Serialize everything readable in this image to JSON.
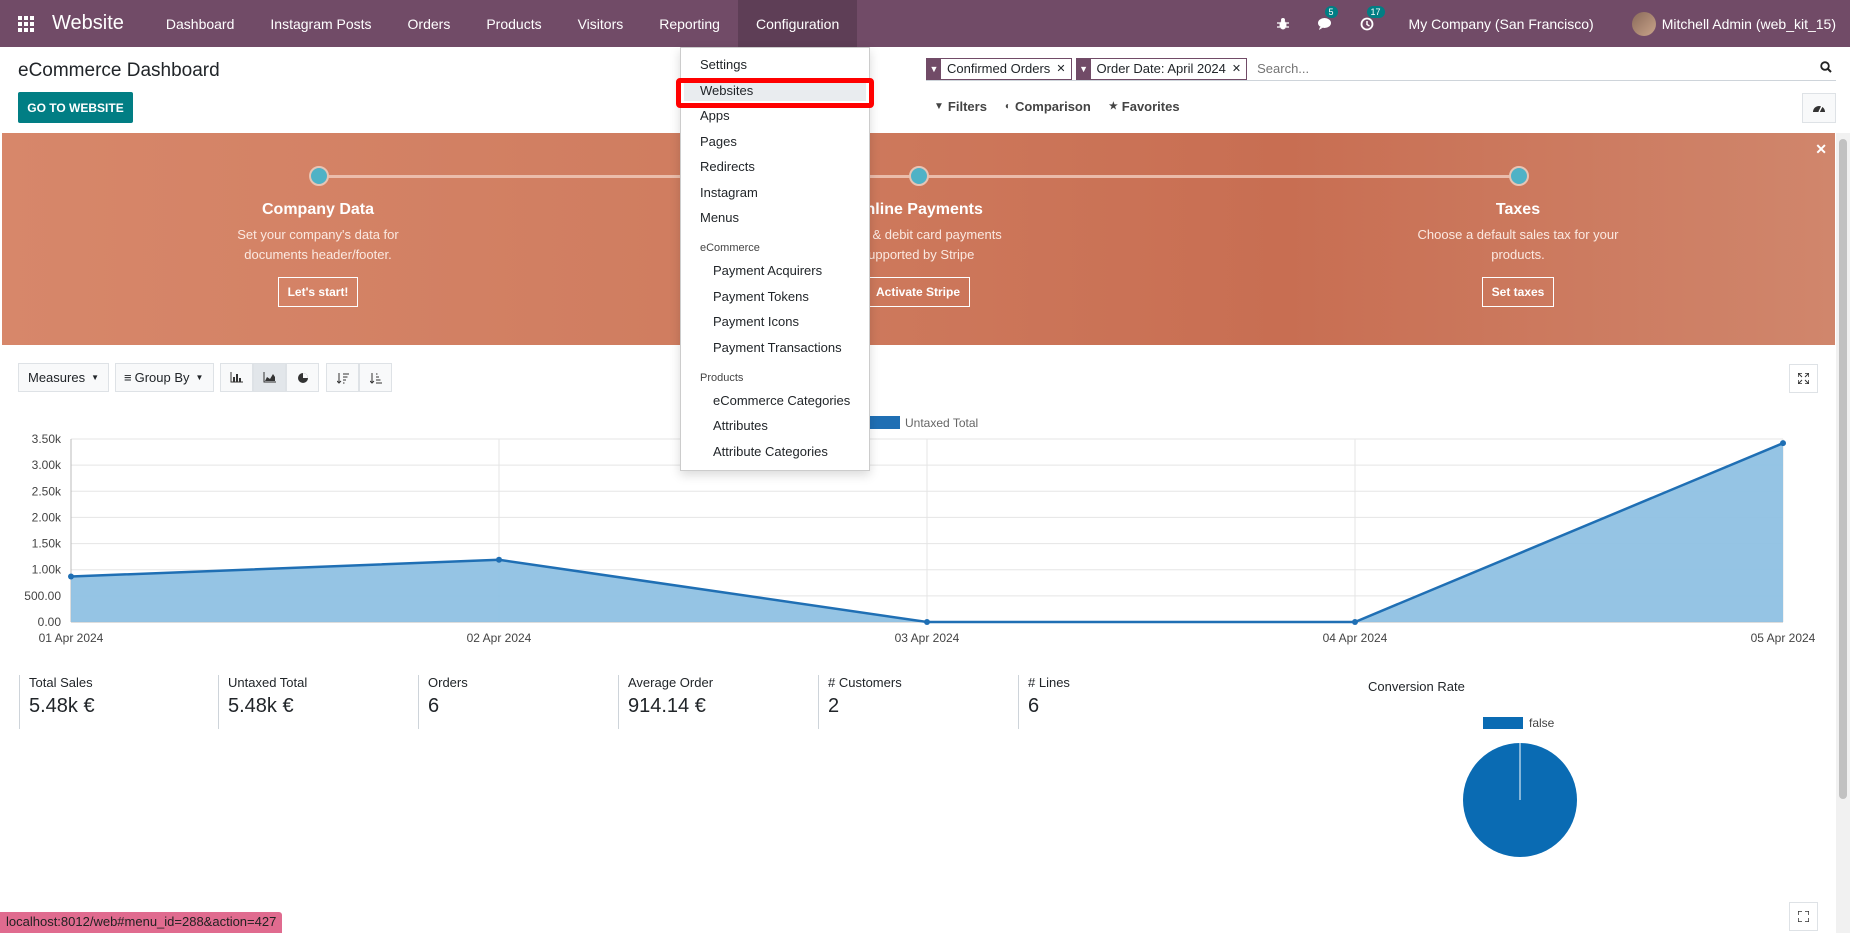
{
  "navbar": {
    "app_name": "Website",
    "menu": [
      "Dashboard",
      "Instagram Posts",
      "Orders",
      "Products",
      "Visitors",
      "Reporting",
      "Configuration"
    ],
    "messages_count": "5",
    "activities_count": "17",
    "company": "My Company (San Francisco)",
    "user": "Mitchell Admin (web_kit_15)",
    "color": "#714B67"
  },
  "control_panel": {
    "title": "eCommerce Dashboard",
    "go_button": "GO TO WEBSITE",
    "facets": [
      "Confirmed Orders",
      "Order Date: April 2024"
    ],
    "search_placeholder": "Search...",
    "filters": "Filters",
    "comparison": "Comparison",
    "favorites": "Favorites"
  },
  "banner": {
    "steps": [
      {
        "title": "Company Data",
        "desc1": "Set your company's data for",
        "desc2": "documents header/footer.",
        "button": "Let's start!"
      },
      {
        "title": "Online Payments",
        "desc1": "Credit & debit card payments",
        "desc2": "supported by Stripe",
        "button": "Activate Stripe"
      },
      {
        "title": "Taxes",
        "desc1": "Choose a default sales tax for your",
        "desc2": "products.",
        "button": "Set taxes"
      }
    ]
  },
  "graph_toolbar": {
    "measures": "Measures",
    "group_by": "Group By"
  },
  "chart_data": {
    "type": "area",
    "x": [
      "01 Apr 2024",
      "02 Apr 2024",
      "03 Apr 2024",
      "04 Apr 2024",
      "05 Apr 2024"
    ],
    "series": [
      {
        "name": "Untaxed Total",
        "values": [
          870,
          1190,
          0,
          0,
          3420
        ]
      }
    ],
    "yticks": [
      "0.00",
      "500.00",
      "1.00k",
      "1.50k",
      "2.00k",
      "2.50k",
      "3.00k",
      "3.50k"
    ],
    "ylim": [
      0,
      3500
    ],
    "line_color": "#1f6fb4",
    "fill_color": "#8fc1e3"
  },
  "kpis": [
    {
      "label": "Total Sales",
      "value": "5.48k €"
    },
    {
      "label": "Untaxed Total",
      "value": "5.48k €"
    },
    {
      "label": "Orders",
      "value": "6"
    },
    {
      "label": "Average Order",
      "value": "914.14 €"
    },
    {
      "label": "# Customers",
      "value": "2"
    },
    {
      "label": "# Lines",
      "value": "6"
    }
  ],
  "conversion": {
    "title": "Conversion Rate",
    "legend": "false"
  },
  "dropdown": {
    "items": [
      "Settings",
      "Websites",
      "Apps",
      "Pages",
      "Redirects",
      "Instagram",
      "Menus"
    ],
    "ecommerce_header": "eCommerce",
    "ecommerce_items": [
      "Payment Acquirers",
      "Payment Tokens",
      "Payment Icons",
      "Payment Transactions"
    ],
    "products_header": "Products",
    "products_items": [
      "eCommerce Categories",
      "Attributes",
      "Attribute Categories"
    ]
  },
  "status_url": "localhost:8012/web#menu_id=288&action=427"
}
